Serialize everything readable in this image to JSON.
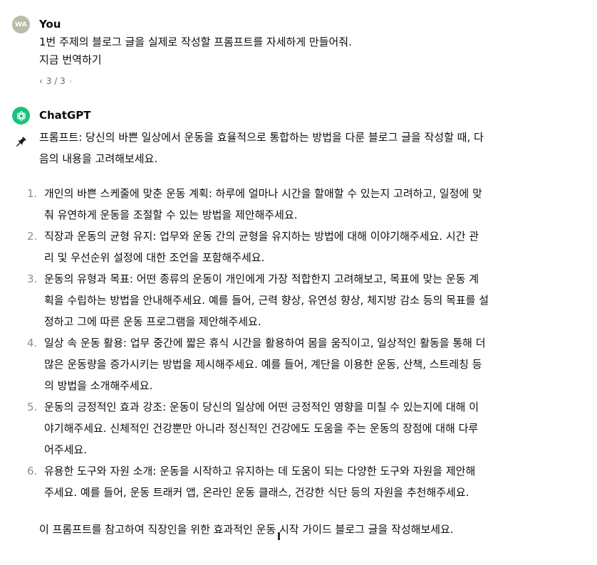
{
  "user_message": {
    "avatar_initials": "WA",
    "author": "You",
    "lines": [
      "1번 주제의 블로그 글을 실제로 작성할 프롬프트를 자세하게 만들어줘.",
      "지금 번역하기"
    ],
    "pager": {
      "prev": "‹",
      "label": "3 / 3",
      "next": "›"
    }
  },
  "assistant_message": {
    "author": "ChatGPT",
    "intro_lines": [
      "프롬프트: 당신의 바쁜 일상에서 운동을 효율적으로 통합하는 방법을 다룬 블로그 글을 작성할 때, 다",
      "음의 내용을 고려해보세요."
    ],
    "items": [
      {
        "num": "1.",
        "lines": [
          "개인의 바쁜 스케줄에 맞춘 운동 계획: 하루에 얼마나 시간을 할애할 수 있는지 고려하고, 일정에 맞",
          "춰 유연하게 운동을 조절할 수 있는 방법을 제안해주세요."
        ]
      },
      {
        "num": "2.",
        "lines": [
          "직장과 운동의 균형 유지: 업무와 운동 간의 균형을 유지하는 방법에 대해 이야기해주세요. 시간 관",
          "리 및 우선순위 설정에 대한 조언을 포함해주세요."
        ]
      },
      {
        "num": "3.",
        "lines": [
          "운동의 유형과 목표: 어떤 종류의 운동이 개인에게 가장 적합한지 고려해보고, 목표에 맞는 운동 계",
          "획을 수립하는 방법을 안내해주세요. 예를 들어, 근력 향상, 유연성 향상, 체지방 감소 등의 목표를 설",
          "정하고 그에 따른 운동 프로그램을 제안해주세요."
        ]
      },
      {
        "num": "4.",
        "lines": [
          "일상 속 운동 활용: 업무 중간에 짧은 휴식 시간을 활용하여 몸을 움직이고, 일상적인 활동을 통해 더",
          "많은 운동량을 증가시키는 방법을 제시해주세요. 예를 들어, 계단을 이용한 운동, 산책, 스트레칭 등",
          "의 방법을 소개해주세요."
        ]
      },
      {
        "num": "5.",
        "lines": [
          "운동의 긍정적인 효과 강조: 운동이 당신의 일상에 어떤 긍정적인 영향을 미칠 수 있는지에 대해 이",
          "야기해주세요. 신체적인 건강뿐만 아니라 정신적인 건강에도 도움을 주는 운동의 장점에 대해 다루",
          "어주세요."
        ]
      },
      {
        "num": "6.",
        "lines": [
          "유용한 도구와 자원 소개: 운동을 시작하고 유지하는 데 도움이 되는 다양한 도구와 자원을 제안해",
          "주세요. 예를 들어, 운동 트래커 앱, 온라인 운동 클래스, 건강한 식단 등의 자원을 추천해주세요."
        ]
      }
    ],
    "outro": "이 프롬프트를 참고하여 직장인을 위한 효과적인 운동 시작 가이드 블로그 글을 작성해보세요."
  },
  "colors": {
    "user_avatar": "#b9bca6",
    "assistant_avatar": "#19c37d",
    "text": "#0d0d0d",
    "muted": "#8e8e8e"
  },
  "icons": {
    "assistant_avatar": "openai-logo-icon",
    "pin": "pin-icon"
  }
}
